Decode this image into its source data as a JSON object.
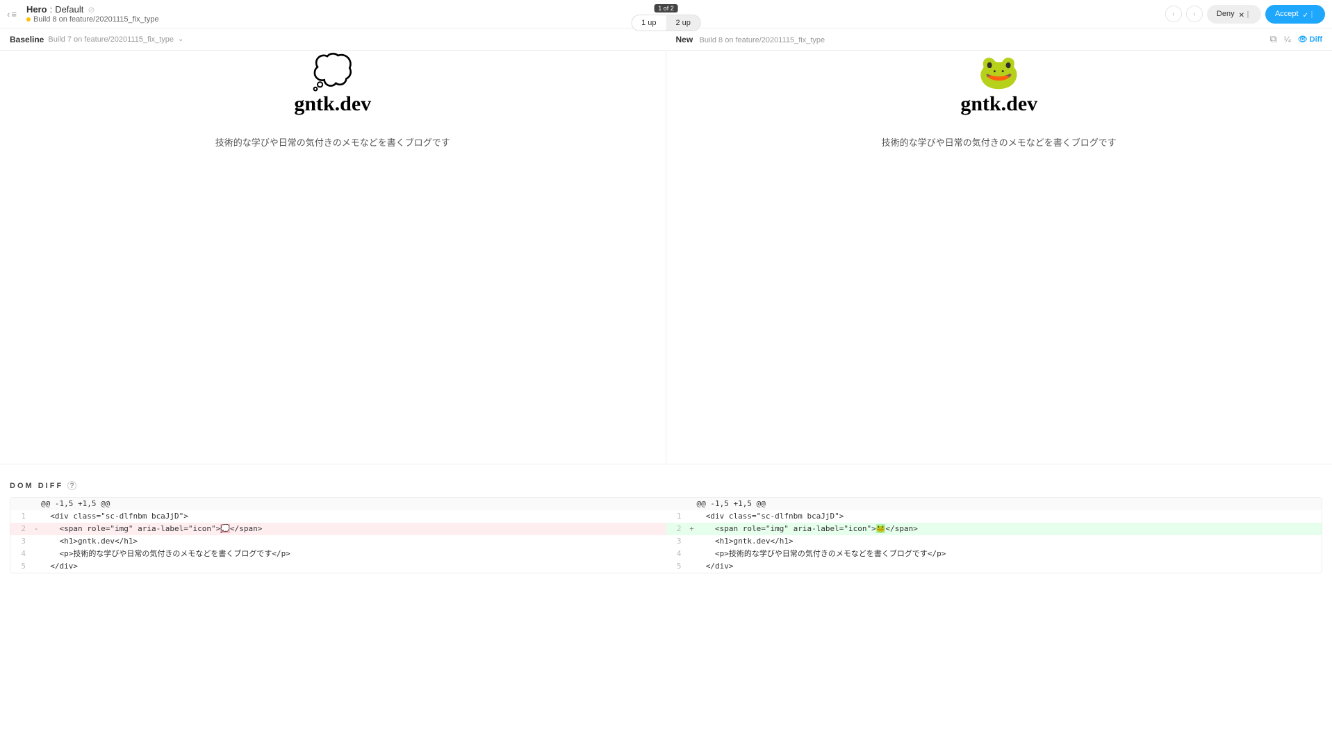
{
  "header": {
    "component": "Hero",
    "variant": "Default",
    "subtitle": "Build 8 on feature/20201115_fix_type",
    "counter": "1 of 2",
    "view_1up": "1 up",
    "view_2up": "2 up",
    "deny": "Deny",
    "accept": "Accept"
  },
  "subheader": {
    "baseline_label": "Baseline",
    "baseline_build": "Build 7 on feature/20201115_fix_type",
    "new_label": "New",
    "new_build": "Build 8 on feature/20201115_fix_type",
    "diff_label": "Diff"
  },
  "canvas": {
    "baseline_logo": "💭",
    "baseline_title": "gntk.dev",
    "baseline_desc": "技術的な学びや日常の気付きのメモなどを書くブログです",
    "new_logo": "🐸",
    "new_title": "gntk.dev",
    "new_desc": "技術的な学びや日常の気付きのメモなどを書くブログです"
  },
  "domdiff": {
    "heading": "DOM DIFF",
    "hunk": "@@ -1,5 +1,5 @@",
    "left": {
      "lines": [
        {
          "n": "1",
          "s": "",
          "t": "  <div class=\"sc-dlfnbm bcaJjD\">"
        },
        {
          "n": "2",
          "s": "-",
          "t": "    <span role=\"img\" aria-label=\"icon\">",
          "hl": "💭",
          "tail": "</span>",
          "cls": "del"
        },
        {
          "n": "3",
          "s": "",
          "t": "    <h1>gntk.dev</h1>"
        },
        {
          "n": "4",
          "s": "",
          "t": "    <p>技術的な学びや日常の気付きのメモなどを書くブログです</p>"
        },
        {
          "n": "5",
          "s": "",
          "t": "  </div>"
        }
      ]
    },
    "right": {
      "lines": [
        {
          "n": "1",
          "s": "",
          "t": "  <div class=\"sc-dlfnbm bcaJjD\">"
        },
        {
          "n": "2",
          "s": "+",
          "t": "    <span role=\"img\" aria-label=\"icon\">",
          "hl": "🐸",
          "tail": "</span>",
          "cls": "add"
        },
        {
          "n": "3",
          "s": "",
          "t": "    <h1>gntk.dev</h1>"
        },
        {
          "n": "4",
          "s": "",
          "t": "    <p>技術的な学びや日常の気付きのメモなどを書くブログです</p>"
        },
        {
          "n": "5",
          "s": "",
          "t": "  </div>"
        }
      ]
    }
  }
}
